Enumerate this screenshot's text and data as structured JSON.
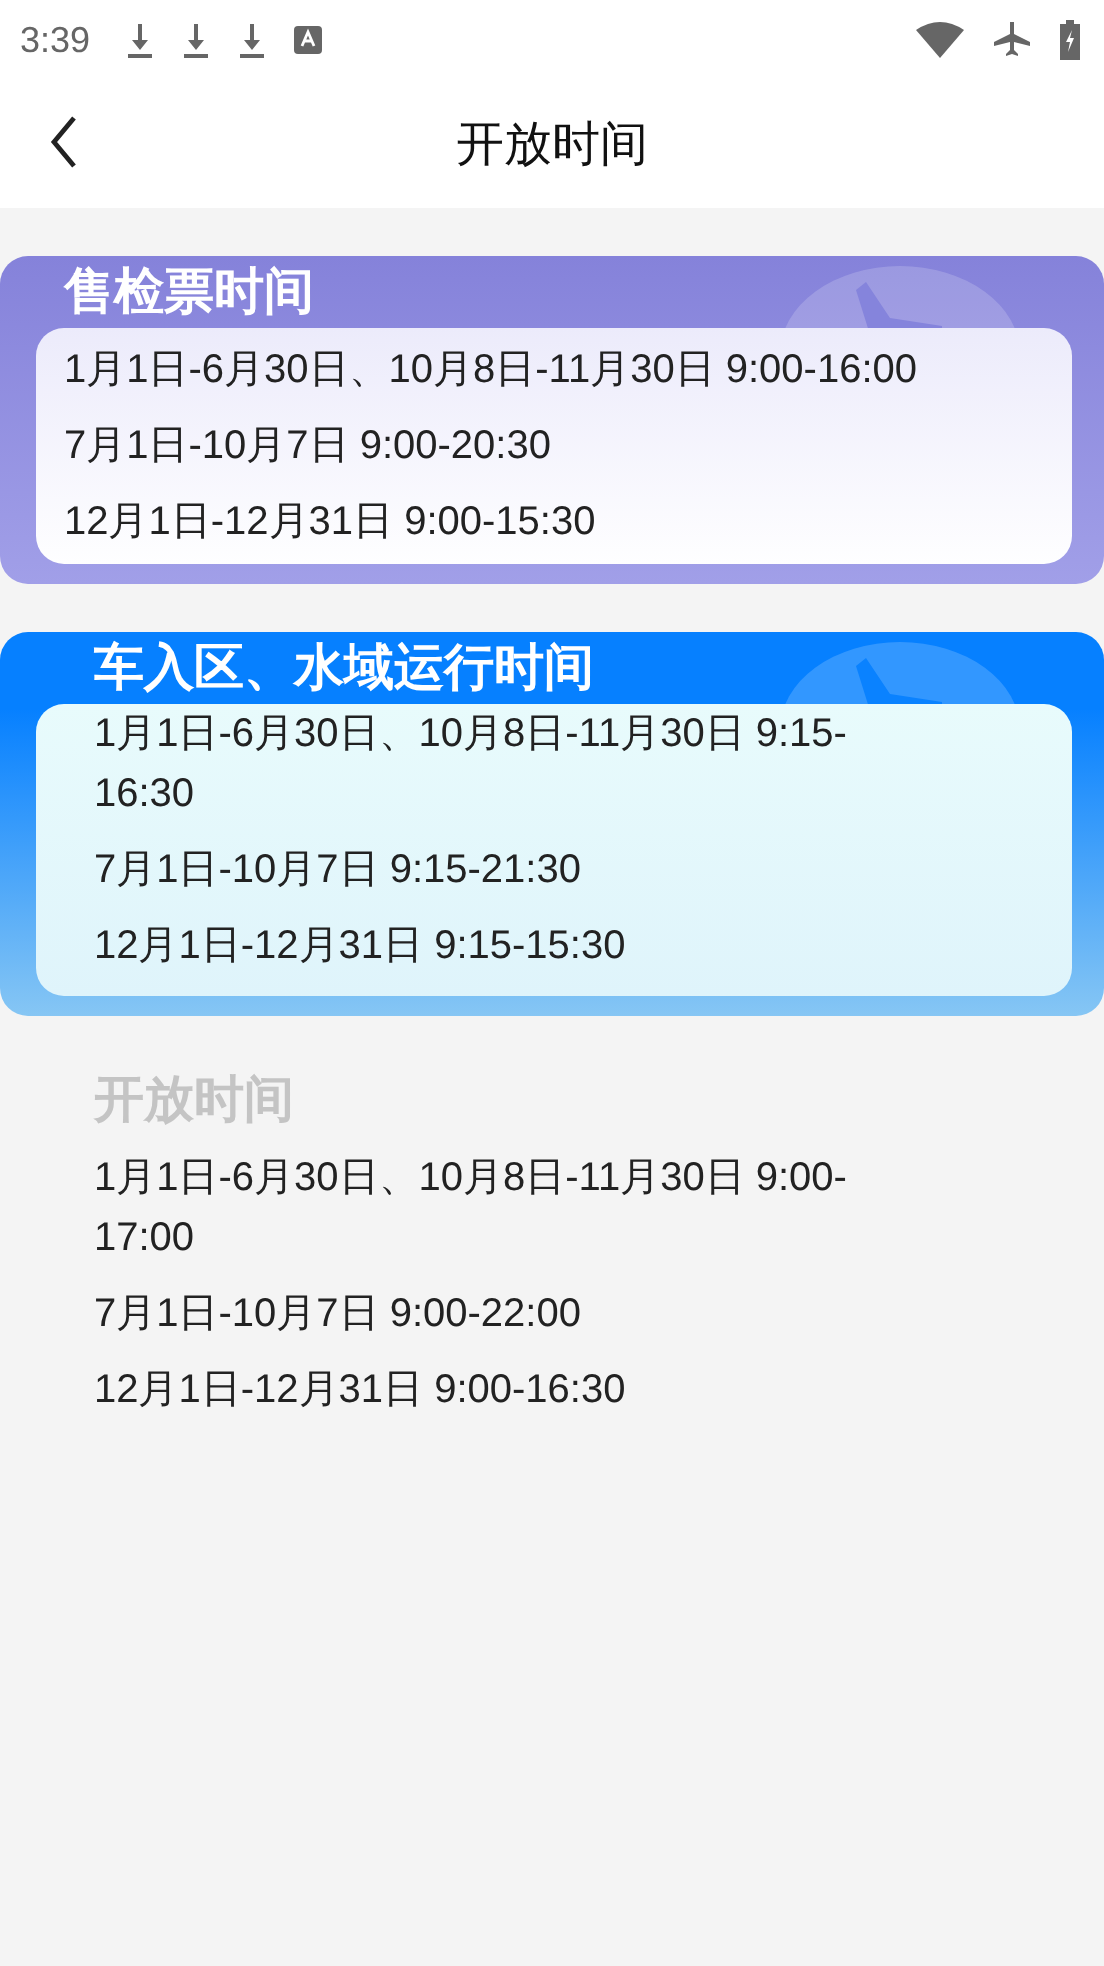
{
  "status_bar": {
    "time": "3:39"
  },
  "header": {
    "title": "开放时间"
  },
  "sections": [
    {
      "kind": "purple",
      "title": "售检票时间",
      "lines": [
        "1月1日-6月30日、10月8日-11月30日 9:00-16:00",
        "7月1日-10月7日 9:00-20:30",
        "12月1日-12月31日 9:00-15:30"
      ]
    },
    {
      "kind": "blue",
      "title": "车入区、水域运行时间",
      "lines": [
        "1月1日-6月30日、10月8日-11月30日 9:15-16:30",
        "7月1日-10月7日 9:15-21:30",
        "12月1日-12月31日 9:15-15:30"
      ]
    },
    {
      "kind": "plain",
      "title": "开放时间",
      "lines": [
        "1月1日-6月30日、10月8日-11月30日 9:00-17:00",
        "7月1日-10月7日 9:00-22:00",
        "12月1日-12月31日 9:00-16:30"
      ]
    }
  ]
}
